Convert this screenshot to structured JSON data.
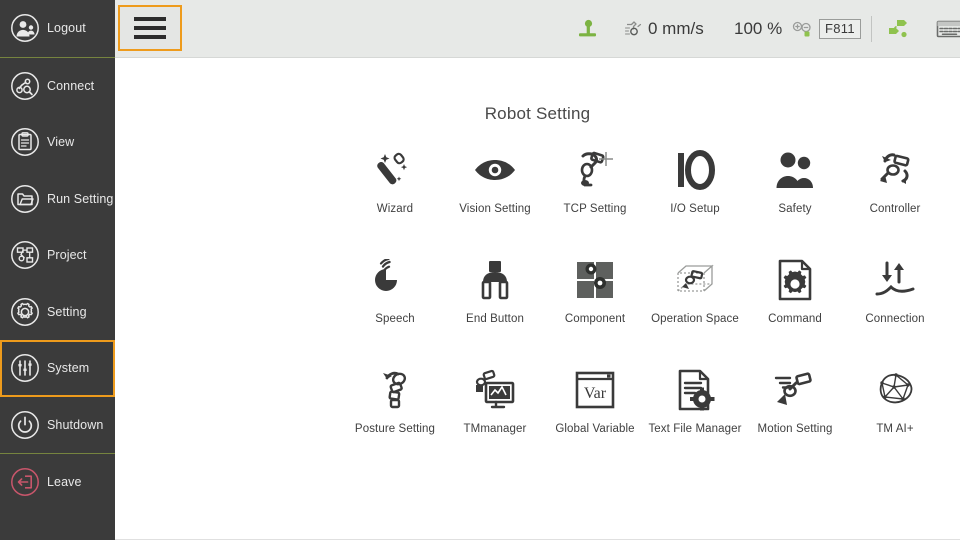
{
  "sidebar": {
    "items": [
      {
        "label": "Logout",
        "icon": "user-logout-icon",
        "selected": false,
        "accent": "#e8e8e8"
      },
      {
        "label": "Connect",
        "icon": "connect-icon",
        "selected": false,
        "accent": "#e8e8e8"
      },
      {
        "label": "View",
        "icon": "view-icon",
        "selected": false,
        "accent": "#e8e8e8"
      },
      {
        "label": "Run Setting",
        "icon": "run-setting-icon",
        "selected": false,
        "accent": "#e8e8e8"
      },
      {
        "label": "Project",
        "icon": "project-icon",
        "selected": false,
        "accent": "#e8e8e8"
      },
      {
        "label": "Setting",
        "icon": "gear-icon",
        "selected": false,
        "accent": "#e8e8e8"
      },
      {
        "label": "System",
        "icon": "sliders-icon",
        "selected": true,
        "accent": "#e8e8e8"
      },
      {
        "label": "Shutdown",
        "icon": "power-icon",
        "selected": false,
        "accent": "#e8e8e8"
      },
      {
        "label": "Leave",
        "icon": "leave-icon",
        "selected": false,
        "accent": "#c8566b"
      }
    ],
    "separator_color": "#76843f",
    "selected_border_color": "#ee9b1c",
    "background": "#3b3b3b"
  },
  "topbar": {
    "menu_button": "hamburger-menu-button",
    "jog_icon": "joystick-icon",
    "jog_color": "#7cb342",
    "speed_icon": "robot-speed-icon",
    "speed_value": "0 mm/s",
    "speed_percent": "100 %",
    "zoom_icon": "zoom-in-out-icon",
    "project_badge": "F811",
    "right_icons": [
      {
        "name": "network-flow-icon",
        "color": "#7cb342"
      },
      {
        "name": "keyboard-icon",
        "color": "#6a6c6a"
      },
      {
        "name": "info-icon",
        "color": "#6a6c6a"
      },
      {
        "name": "log-icon",
        "color": "#6a6c6a"
      }
    ]
  },
  "main": {
    "title": "Robot Setting",
    "tiles": [
      {
        "label": "Wizard",
        "icon": "magic-wand-icon"
      },
      {
        "label": "Vision Setting",
        "icon": "eye-icon"
      },
      {
        "label": "TCP Setting",
        "icon": "tcp-robot-crosshair-icon"
      },
      {
        "label": "I/O Setup",
        "icon": "io-text-icon"
      },
      {
        "label": "Safety",
        "icon": "two-people-icon"
      },
      {
        "label": "Controller",
        "icon": "robot-arm-rotate-icon"
      },
      {
        "label": "Speech",
        "icon": "speech-sound-icon"
      },
      {
        "label": "End Button",
        "icon": "gripper-icon"
      },
      {
        "label": "Component",
        "icon": "component-squares-gear-icon"
      },
      {
        "label": "Operation Space",
        "icon": "3d-box-robot-icon"
      },
      {
        "label": "Command",
        "icon": "document-gear-icon"
      },
      {
        "label": "Connection",
        "icon": "up-down-arrows-curve-icon"
      },
      {
        "label": "Posture Setting",
        "icon": "robot-posture-rotate-icon"
      },
      {
        "label": "TMmanager",
        "icon": "robot-monitor-icon"
      },
      {
        "label": "Global Variable",
        "icon": "var-window-icon"
      },
      {
        "label": "Text File Manager",
        "icon": "document-lines-gear-icon"
      },
      {
        "label": "Motion Setting",
        "icon": "robot-motion-lines-icon"
      },
      {
        "label": "TM AI+",
        "icon": "brain-network-icon"
      }
    ]
  }
}
